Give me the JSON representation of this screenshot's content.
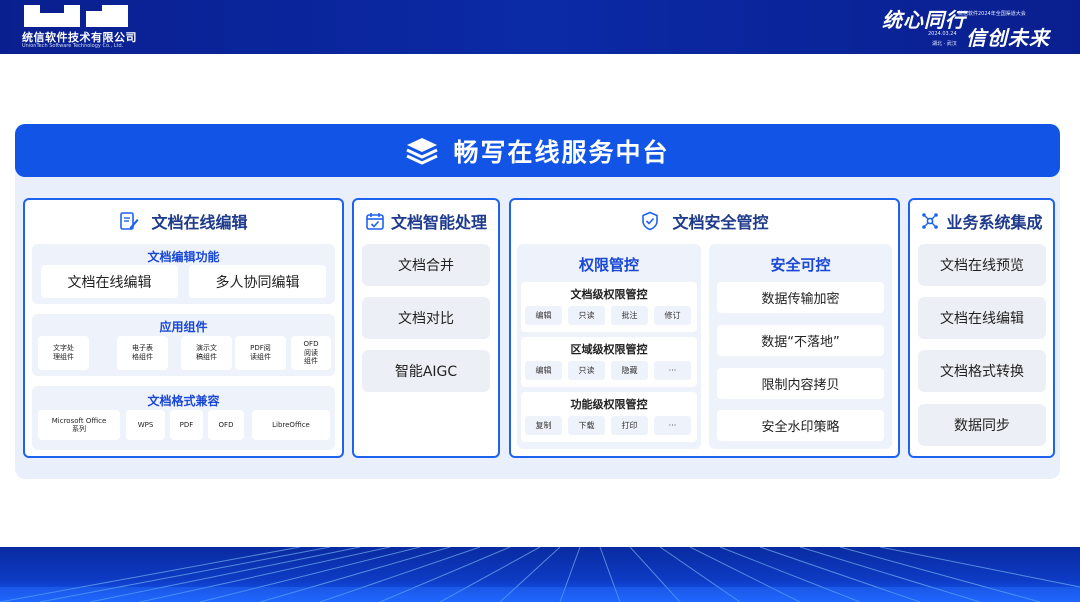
{
  "header": {
    "company_name": "统信软件技术有限公司",
    "company_name_en": "UnionTech Software Technology Co., Ltd.",
    "slogan_line1": "统心同行",
    "slogan_line2": "信创未来",
    "conference": "统信软件2024年全国渠道大会",
    "date": "2024.03.24",
    "city": "湖北 · 武汉"
  },
  "banner": {
    "title": "畅写在线服务中台",
    "icon": "layers-icon"
  },
  "columns": {
    "edit": {
      "title": "文档在线编辑",
      "icon": "edit-document-icon",
      "features": {
        "title": "文档编辑功能",
        "items": [
          "文档在线编辑",
          "多人协同编辑"
        ]
      },
      "components": {
        "title": "应用组件",
        "items": [
          "文字处\n理组件",
          "电子表\n格组件",
          "演示文\n稿组件",
          "PDF阅\n读组件",
          "OFD\n阅读\n组件"
        ]
      },
      "formats": {
        "title": "文档格式兼容",
        "items": [
          "Microsoft Office\n系列",
          "WPS",
          "PDF",
          "OFD",
          "LibreOffice"
        ]
      }
    },
    "ai": {
      "title": "文档智能处理",
      "icon": "calendar-check-icon",
      "items": [
        "文档合并",
        "文档对比",
        "智能AIGC"
      ]
    },
    "security": {
      "title": "文档安全管控",
      "icon": "shield-check-icon",
      "permission": {
        "title": "权限管控",
        "groups": [
          {
            "title": "文档级权限管控",
            "items": [
              "编辑",
              "只读",
              "批注",
              "修订"
            ]
          },
          {
            "title": "区域级权限管控",
            "items": [
              "编辑",
              "只读",
              "隐藏",
              "···"
            ]
          },
          {
            "title": "功能级权限管控",
            "items": [
              "复制",
              "下载",
              "打印",
              "···"
            ]
          }
        ]
      },
      "controllable": {
        "title": "安全可控",
        "items": [
          "数据传输加密",
          "数据“不落地”",
          "限制内容拷贝",
          "安全水印策略"
        ]
      }
    },
    "integration": {
      "title": "业务系统集成",
      "icon": "network-icon",
      "items": [
        "文档在线预览",
        "文档在线编辑",
        "文档格式转换",
        "数据同步"
      ]
    }
  },
  "colors": {
    "primary": "#1255e6",
    "header_bg": "#0b2aa6",
    "panel_bg": "#e9f0fc",
    "accent_text": "#1a48d6"
  }
}
